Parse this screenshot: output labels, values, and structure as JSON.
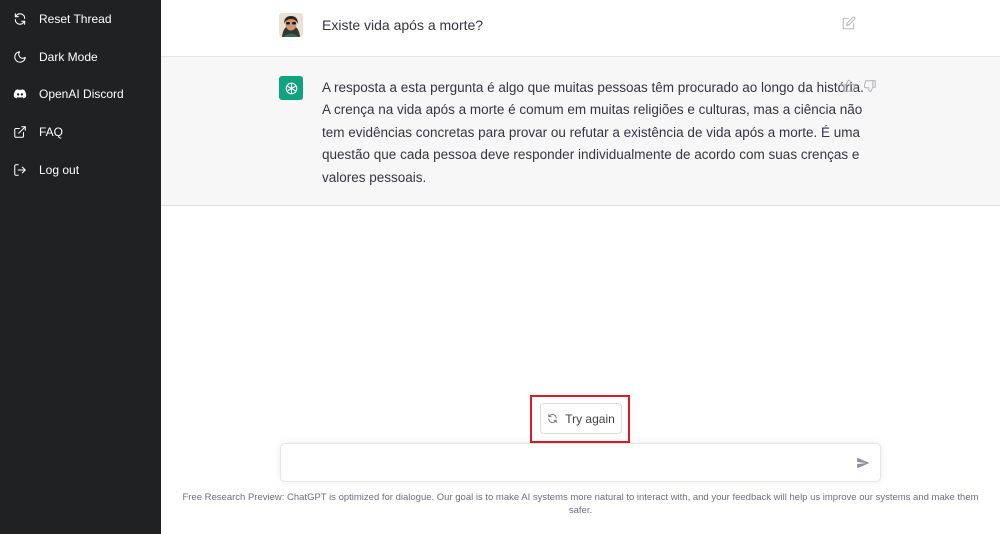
{
  "sidebar": {
    "items": [
      {
        "label": "Reset Thread",
        "icon": "refresh-icon"
      },
      {
        "label": "Dark Mode",
        "icon": "moon-icon"
      },
      {
        "label": "OpenAI Discord",
        "icon": "discord-icon"
      },
      {
        "label": "FAQ",
        "icon": "external-link-icon"
      },
      {
        "label": "Log out",
        "icon": "logout-icon"
      }
    ]
  },
  "conversation": {
    "user_message": "Existe vida após a morte?",
    "assistant_lines": [
      "A resposta a esta pergunta é algo que muitas pessoas têm procurado ao longo da história.",
      "A crença na vida após a morte é comum em muitas religiões e culturas, mas a ciência não",
      "tem evidências concretas para provar ou refutar a existência de vida após a morte. É uma",
      "questão que cada pessoa deve responder individualmente de acordo com suas crenças e",
      "valores pessoais."
    ]
  },
  "actions": {
    "try_again_label": "Try again"
  },
  "composer": {
    "value": "",
    "placeholder": ""
  },
  "footer": {
    "text": "Free Research Preview: ChatGPT is optimized for dialogue. Our goal is to make AI systems more natural to interact with, and your feedback will help us improve our systems and make them safer."
  },
  "colors": {
    "sidebar_bg": "#202123",
    "assistant_row_bg": "#f7f7f8",
    "assistant_avatar": "#10a37f",
    "highlight": "#e01b24"
  }
}
